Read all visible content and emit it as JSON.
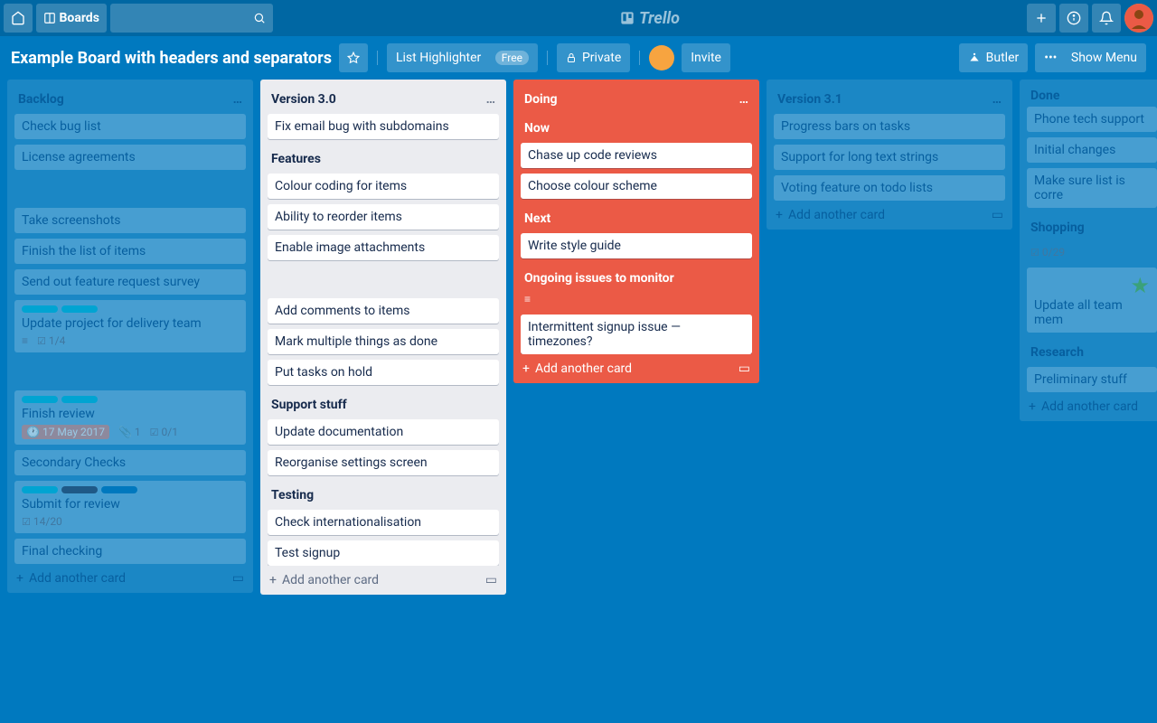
{
  "topbar": {
    "boards": "Boards",
    "logo": "Trello"
  },
  "boardbar": {
    "title": "Example Board with headers and separators",
    "listHighlighter": "List Highlighter",
    "free": "Free",
    "private": "Private",
    "invite": "Invite",
    "butler": "Butler",
    "showMenu": "Show Menu"
  },
  "lists": {
    "backlog": {
      "title": "Backlog",
      "cards": [
        "Check bug list",
        "License agreements",
        "Take screenshots",
        "Finish the list of items",
        "Send out feature request survey"
      ],
      "delivery": {
        "text": "Update project for delivery team",
        "check": "1/4"
      },
      "review": {
        "text": "Finish review",
        "date": "17 May 2017",
        "attach": "1",
        "check": "0/1"
      },
      "secondary": "Secondary Checks",
      "submit": {
        "text": "Submit for review",
        "check": "14/20"
      },
      "final": "Final checking",
      "add": "Add another card"
    },
    "v3": {
      "title": "Version 3.0",
      "c1": "Fix email bug with subdomains",
      "s1": "Features",
      "c2": "Colour coding for items",
      "c3": "Ability to reorder items",
      "c4": "Enable image attachments",
      "c5": "Add comments to items",
      "c6": "Mark multiple things as done",
      "c7": "Put tasks on hold",
      "s2": "Support stuff",
      "c8": "Update documentation",
      "c9": "Reorganise settings screen",
      "s3": "Testing",
      "c10": "Check internationalisation",
      "c11": "Test signup",
      "add": "Add another card"
    },
    "doing": {
      "title": "Doing",
      "s1": "Now",
      "c1": "Chase up code reviews",
      "c2": "Choose colour scheme",
      "s2": "Next",
      "c3": "Write style guide",
      "s3": "Ongoing issues to monitor",
      "c4": "Intermittent signup issue — timezones?",
      "add": "Add another card"
    },
    "v31": {
      "title": "Version 3.1",
      "c1": "Progress bars on tasks",
      "c2": "Support for long text strings",
      "c3": "Voting feature on todo lists",
      "add": "Add another card"
    },
    "done": {
      "title": "Done",
      "c1": "Phone tech support",
      "c2": "Initial changes",
      "c3": "Make sure list is corre",
      "s1": "Shopping",
      "check": "0/29",
      "c4": "Update all team mem",
      "s2": "Research",
      "c5": "Preliminary stuff",
      "add": "Add another card"
    }
  }
}
